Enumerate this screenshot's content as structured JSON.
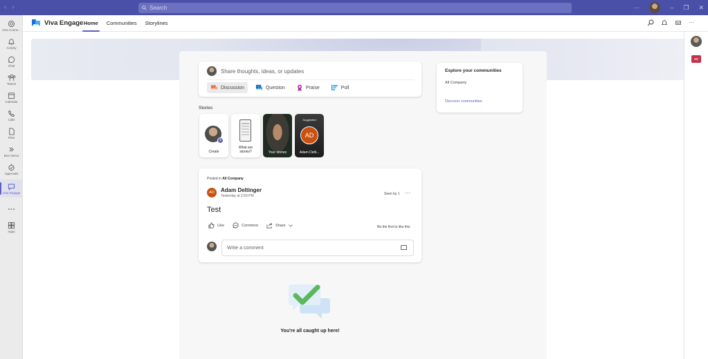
{
  "titlebar": {
    "back": "‹",
    "forward": "›",
    "search_placeholder": "Search",
    "more": "···",
    "minimize": "–",
    "restore": "❐",
    "close": "✕"
  },
  "rail": {
    "items": [
      {
        "label": "Viva Conne...",
        "icon": "viva-connections-icon"
      },
      {
        "label": "Activity",
        "icon": "bell-icon"
      },
      {
        "label": "Chat",
        "icon": "chat-icon"
      },
      {
        "label": "Teams",
        "icon": "teams-icon"
      },
      {
        "label": "Calendar",
        "icon": "calendar-icon"
      },
      {
        "label": "Calls",
        "icon": "phone-icon"
      },
      {
        "label": "Files",
        "icon": "file-icon"
      },
      {
        "label": "Bizz Demo",
        "icon": "app-icon"
      },
      {
        "label": "Approvals",
        "icon": "approvals-icon"
      },
      {
        "label": "Viva Engage",
        "icon": "engage-icon",
        "active": true
      },
      {
        "label": "",
        "icon": "more-icon"
      },
      {
        "label": "Apps",
        "icon": "apps-icon"
      }
    ]
  },
  "header": {
    "brand": "Viva Engage",
    "tabs": [
      {
        "label": "Home",
        "active": true
      },
      {
        "label": "Communities",
        "active": false
      },
      {
        "label": "Storylines",
        "active": false
      }
    ],
    "more": "···"
  },
  "right_panel": {
    "badge": "AC"
  },
  "composer": {
    "prompt": "Share thoughts, ideas, or updates",
    "types": [
      {
        "label": "Discussion",
        "active": true,
        "color": "#e97548"
      },
      {
        "label": "Question",
        "active": false,
        "color": "#0f6cbd"
      },
      {
        "label": "Praise",
        "active": false,
        "color": "#c239b3"
      },
      {
        "label": "Poll",
        "active": false,
        "color": "#0f9cd8"
      }
    ]
  },
  "explore": {
    "title": "Explore your communities",
    "community": "All Company",
    "discover": "Discover communities"
  },
  "stories": {
    "heading": "Stories",
    "items": [
      {
        "label": "Create"
      },
      {
        "label": "What are stories?"
      },
      {
        "label": "Your stories"
      },
      {
        "label": "Adam Delti...",
        "tag": "Suggested",
        "initials": "AD"
      }
    ]
  },
  "post": {
    "posted_prefix": "Posted in",
    "community": "All Company",
    "initials": "AD",
    "author": "Adam Deltinger",
    "time": "Yesterday at 2:59 PM",
    "seen": "Seen by 1",
    "more": "···",
    "body": "Test",
    "actions": {
      "like": "Like",
      "comment": "Comment",
      "share": "Share"
    },
    "first_like": "Be the first to like this",
    "comment_placeholder": "Write a comment"
  },
  "caught_up": "You're all caught up here!",
  "colors": {
    "accent": "#5b5fc7",
    "titlebar": "#4a4fa8",
    "avatar_orange": "#ca5010",
    "check_green": "#5cb85c"
  }
}
